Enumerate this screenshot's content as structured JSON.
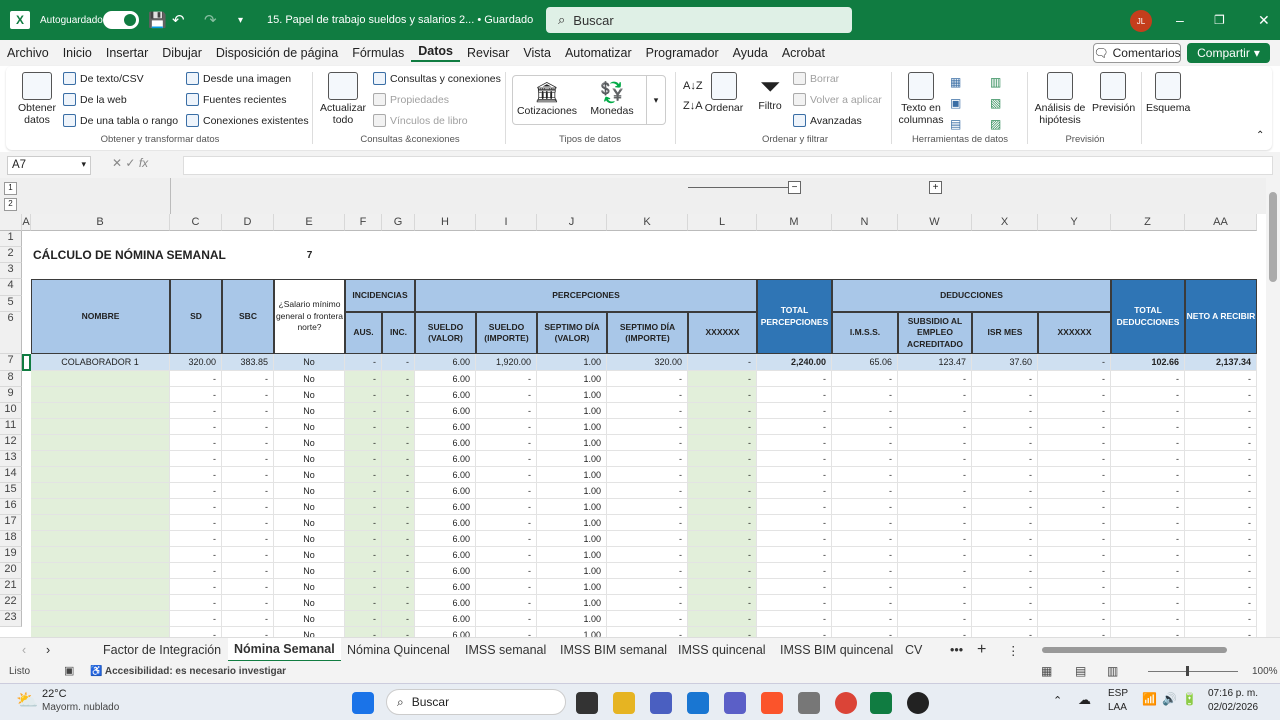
{
  "titlebar": {
    "autosave": "Autoguardado",
    "filename": "15. Papel de trabajo sueldos y salarios 2... • Guardado",
    "search": "Buscar",
    "avatar": "JL"
  },
  "menu": [
    "Archivo",
    "Inicio",
    "Insertar",
    "Dibujar",
    "Disposición de página",
    "Fórmulas",
    "Datos",
    "Revisar",
    "Vista",
    "Automatizar",
    "Programador",
    "Ayuda",
    "Acrobat"
  ],
  "active_menu": "Datos",
  "buttons": {
    "comments": "Comentarios",
    "share": "Compartir"
  },
  "ribbon": {
    "get_data": "Obtener datos",
    "from_text": "De texto/CSV",
    "from_web": "De la web",
    "from_table": "De una tabla o rango",
    "from_image": "Desde una imagen",
    "recent": "Fuentes recientes",
    "existing": "Conexiones existentes",
    "group1": "Obtener y transformar datos",
    "refresh": "Actualizar todo",
    "queries": "Consultas y conexiones",
    "properties": "Propiedades",
    "links": "Vínculos de libro",
    "group2": "Consultas &conexiones",
    "stocks": "Cotizaciones",
    "currencies": "Monedas",
    "group3": "Tipos de datos",
    "sort": "Ordenar",
    "filter": "Filtro",
    "clear": "Borrar",
    "reapply": "Volver a aplicar",
    "advanced": "Avanzadas",
    "group4": "Ordenar y filtrar",
    "text_cols": "Texto en columnas",
    "group5": "Herramientas de datos",
    "whatif": "Análisis de hipótesis",
    "forecast": "Previsión",
    "group6": "Previsión",
    "outline": "Esquema"
  },
  "namebox": "A7",
  "fx": "fx",
  "columns": [
    "A",
    "B",
    "C",
    "D",
    "E",
    "F",
    "G",
    "H",
    "I",
    "J",
    "K",
    "L",
    "M",
    "N",
    "W",
    "X",
    "Y",
    "Z",
    "AA"
  ],
  "sheet": {
    "title": "CÁLCULO DE NÓMINA SEMANAL",
    "days": "7",
    "h_nombre": "NOMBRE",
    "h_sd": "SD",
    "h_sbc": "SBC",
    "h_salario": "¿Salario mínimo general o frontera norte?",
    "h_incidencias": "INCIDENCIAS",
    "h_aus": "AUS.",
    "h_inc": "INC.",
    "h_percepciones": "PERCEPCIONES",
    "h_sueldo_valor": "SUELDO (VALOR)",
    "h_sueldo_importe": "SUELDO (IMPORTE)",
    "h_septimo_valor": "SEPTIMO DÍA (VALOR)",
    "h_septimo_importe": "SEPTIMO DÍA (IMPORTE)",
    "h_x1": "XXXXXX",
    "h_total_perc": "TOTAL PERCEPCIONES",
    "h_deducciones": "DEDUCCIONES",
    "h_imss": "I.M.S.S.",
    "h_subsidio": "SUBSIDIO AL EMPLEO ACREDITADO",
    "h_isr": "ISR MES",
    "h_x2": "XXXXXX",
    "h_total_ded": "TOTAL DEDUCCIONES",
    "h_neto": "NETO A RECIBIR",
    "row7": {
      "nombre": "COLABORADOR 1",
      "sd": "320.00",
      "sbc": "383.85",
      "sal": "No",
      "aus": "-",
      "inc": "-",
      "sv": "6.00",
      "si": "1,920.00",
      "dv": "1.00",
      "di": "320.00",
      "x1": "-",
      "tp": "2,240.00",
      "imss": "65.06",
      "sub": "123.47",
      "isr": "37.60",
      "x2": "-",
      "td": "102.66",
      "neto": "2,137.34"
    },
    "blank_row": {
      "dash": "-",
      "sal": "No",
      "sv": "6.00",
      "dv": "1.00"
    },
    "row_numbers": [
      "8",
      "9",
      "10",
      "11",
      "12",
      "13",
      "14",
      "15",
      "16",
      "17",
      "18",
      "19",
      "20",
      "21",
      "22",
      "23"
    ]
  },
  "tabs": [
    "Factor de Integración",
    "Nómina Semanal",
    "Nómina Quincenal",
    "IMSS semanal",
    "IMSS BIM semanal",
    "IMSS quincenal",
    "IMSS BIM quincenal",
    "CV"
  ],
  "active_tab": "Nómina Semanal",
  "status": {
    "ready": "Listo",
    "accessibility": "Accesibilidad: es necesario investigar",
    "zoom": "100%"
  },
  "taskbar": {
    "temp": "22°C",
    "weather": "Mayorm. nublado",
    "search": "Buscar",
    "lang1": "ESP",
    "lang2": "LAA",
    "time": "07:16 p. m.",
    "date": "02/02/2026"
  }
}
